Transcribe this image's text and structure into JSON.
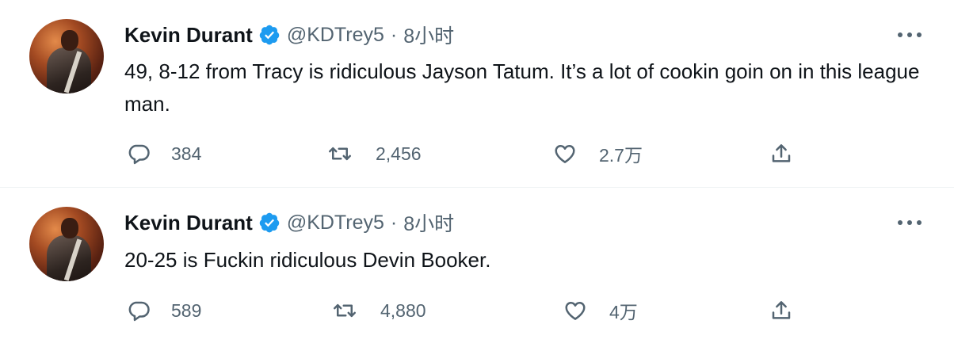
{
  "tweets": [
    {
      "author_name": "Kevin Durant",
      "handle": "@KDTrey5",
      "separator": "·",
      "time": "8小时",
      "text": "49, 8-12 from Tracy is ridiculous Jayson Tatum. It’s a lot of cookin goin on in this league man.",
      "replies": "384",
      "retweets": "2,456",
      "likes": "2.7万"
    },
    {
      "author_name": "Kevin Durant",
      "handle": "@KDTrey5",
      "separator": "·",
      "time": "8小时",
      "text": "20-25 is Fuckin ridiculous Devin Booker.",
      "replies": "589",
      "retweets": "4,880",
      "likes": "4万"
    }
  ],
  "colors": {
    "text": "#0f1419",
    "secondary": "#536471",
    "verified_badge": "#1d9bf0",
    "divider": "#eff3f4"
  },
  "icons": [
    "verified-badge-icon",
    "more-icon",
    "reply-icon",
    "retweet-icon",
    "like-icon",
    "share-icon"
  ]
}
